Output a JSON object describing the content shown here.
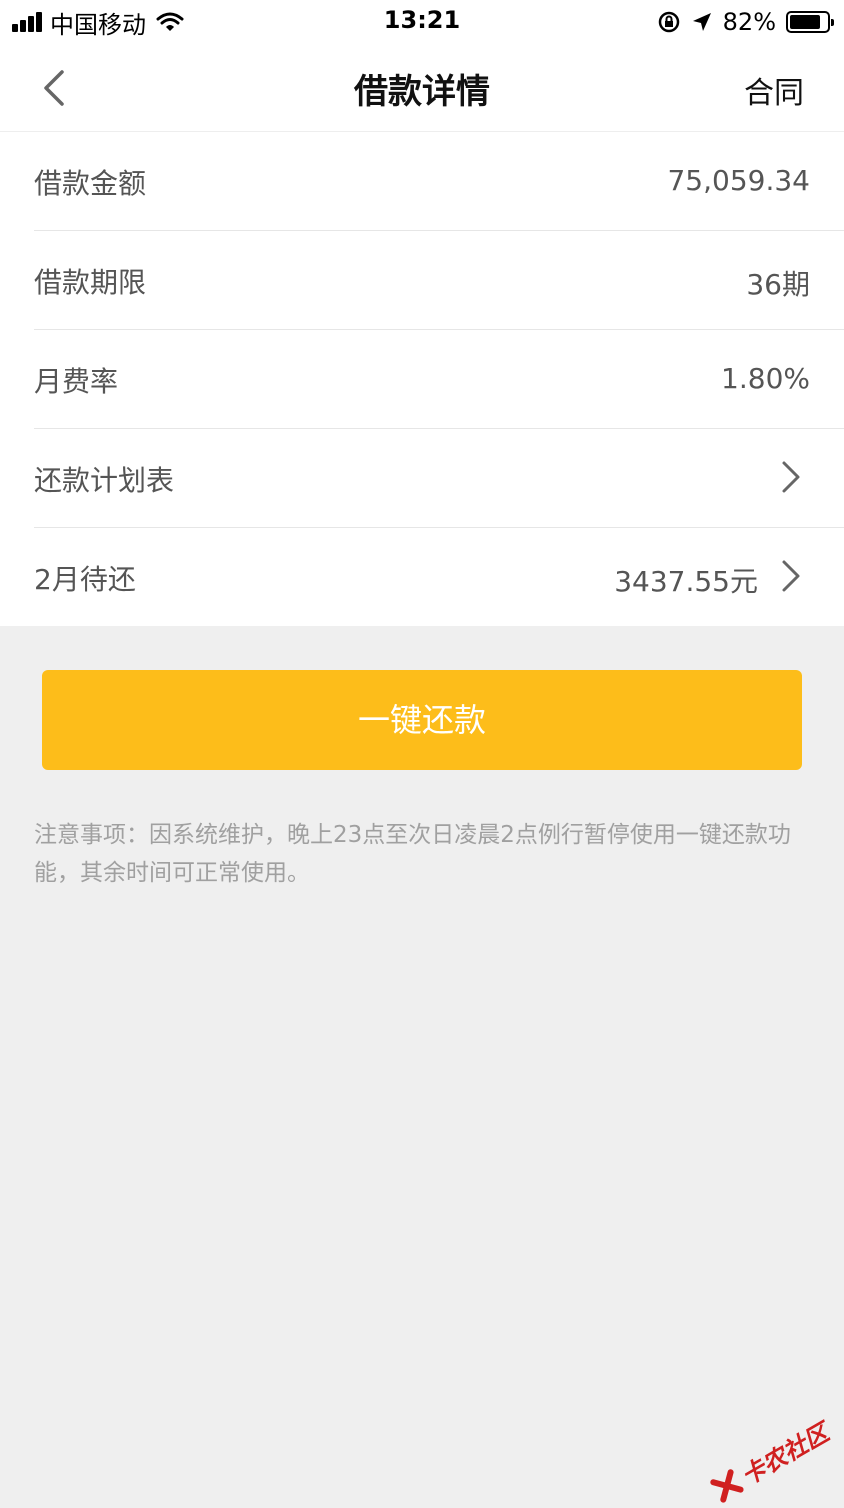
{
  "status_bar": {
    "carrier": "中国移动",
    "time": "13:21",
    "battery_percent": "82%",
    "battery_level": 0.82
  },
  "nav": {
    "title": "借款详情",
    "action": "合同"
  },
  "details": [
    {
      "label": "借款金额",
      "value": "75,059.34"
    },
    {
      "label": "借款期限",
      "value": "36期"
    },
    {
      "label": "月费率",
      "value": "1.80%"
    },
    {
      "label": "还款计划表",
      "value": ""
    },
    {
      "label": "2月待还",
      "value": "3437.55元"
    }
  ],
  "pay_button": {
    "label": "一键还款"
  },
  "notice": "注意事项：因系统维护，晚上23点至次日凌晨2点例行暂停使用一键还款功能，其余时间可正常使用。",
  "watermark": {
    "text": "卡农社区"
  },
  "colors": {
    "accent": "#fdbd1a",
    "watermark": "#d02020"
  }
}
